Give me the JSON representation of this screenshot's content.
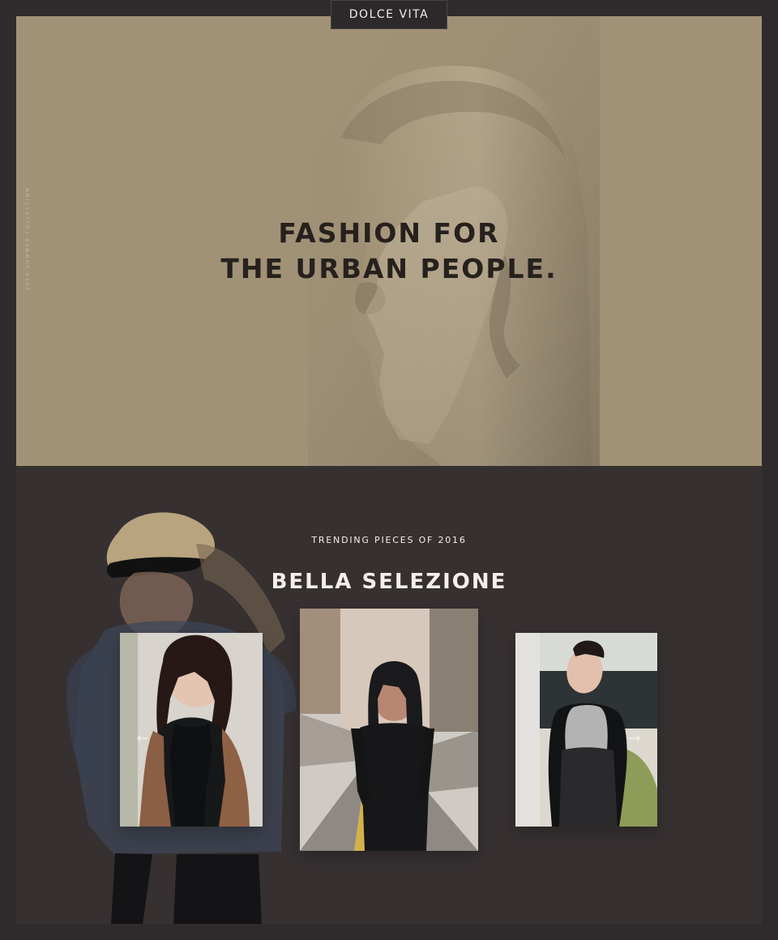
{
  "brand": {
    "name": "DOLCE VITA"
  },
  "hero": {
    "title_line_1": "FASHION FOR",
    "title_line_2": "THE URBAN PEOPLE.",
    "side_label": "2016 SUMMER COLLECTION"
  },
  "collection": {
    "eyebrow": "TRENDING PIECES OF 2016",
    "title": "BELLA SELEZIONE"
  },
  "controls": {
    "prev_icon": "arrow-left-icon",
    "next_icon": "arrow-right-icon"
  },
  "colors": {
    "page_background": "#2f2b2c",
    "hero_background": "#a19277",
    "section_background": "#363031",
    "text_light": "#f4efe9",
    "text_dark": "#26211d"
  }
}
